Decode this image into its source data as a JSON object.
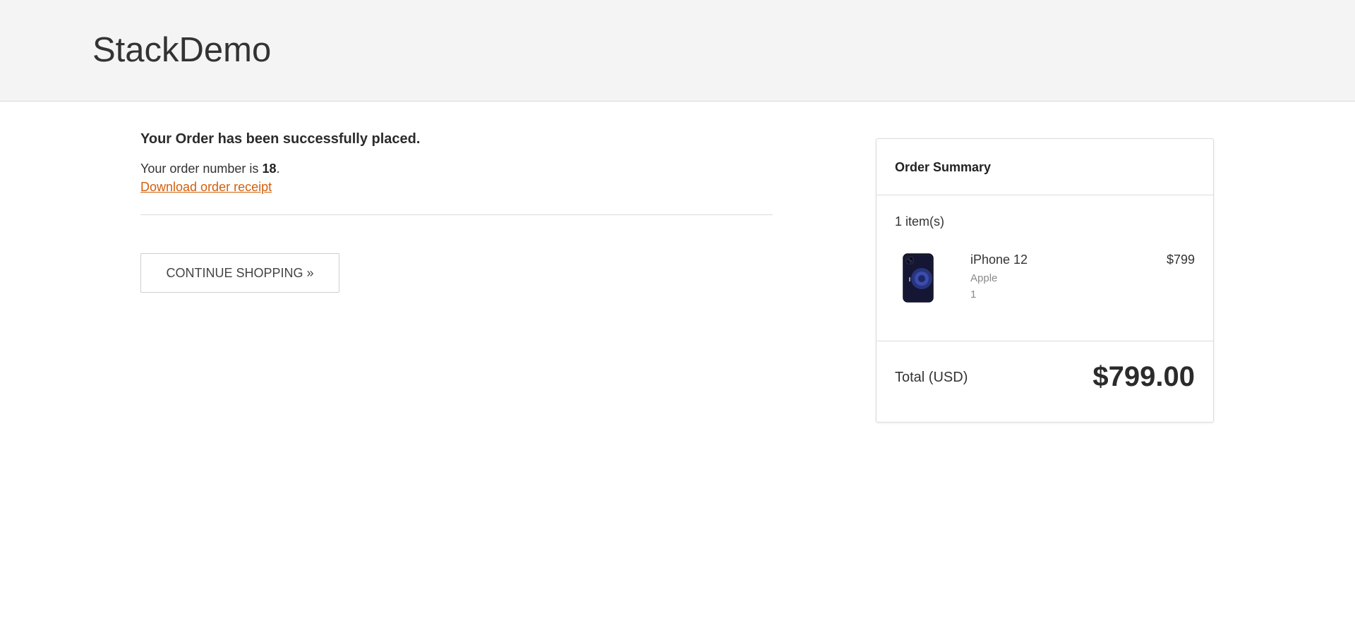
{
  "header": {
    "brand": "StackDemo"
  },
  "confirmation": {
    "title": "Your Order has been successfully placed.",
    "order_prefix": "Your order number is ",
    "order_number": "18",
    "order_suffix": ".",
    "receipt_link": "Download order receipt"
  },
  "actions": {
    "continue_label": "CONTINUE SHOPPING »"
  },
  "summary": {
    "title": "Order Summary",
    "item_count": "1 item(s)",
    "items": [
      {
        "name": "iPhone 12",
        "brand": "Apple",
        "quantity": "1",
        "price": "$799",
        "icon": "iphone-12-product-image"
      }
    ],
    "total_label": "Total (USD)",
    "total_value": "$799.00"
  },
  "colors": {
    "header_bg": "#f4f4f4",
    "link": "#d35f0a",
    "text": "#333333",
    "border": "#dcdcdc"
  }
}
